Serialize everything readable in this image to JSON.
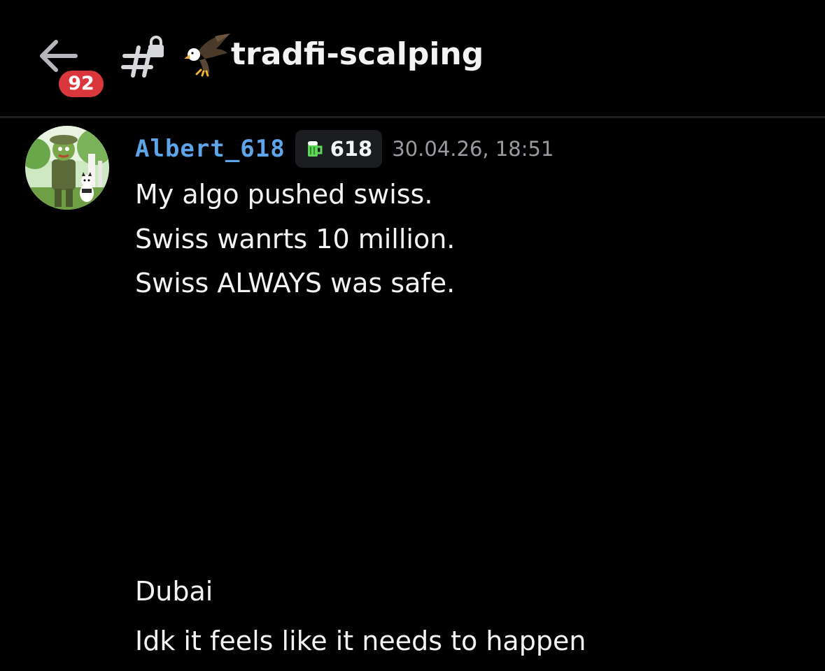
{
  "header": {
    "back_icon": "arrow-left-icon",
    "unread_count": "92",
    "channel_type_icon": "locked-hash-icon",
    "channel_emoji_icon": "eagle-emoji-icon",
    "channel_name": "tradfi-scalping"
  },
  "messages": [
    {
      "author": "Albert_618",
      "tag_icon": "beer-mug-icon",
      "tag_text": "618",
      "timestamp": "30.04.26, 18:51",
      "lines": [
        "My algo pushed swiss.",
        "Swiss wanrts 10 million.",
        "Swiss ALWAYS was safe."
      ]
    },
    {
      "lines": [
        "Dubai",
        "Idk it feels like it needs to happen"
      ]
    }
  ],
  "colors": {
    "background": "#000000",
    "username": "#5da4e8",
    "badge": "#da373c",
    "timestamp": "#9a9ba1",
    "text": "#f2f3f5"
  }
}
